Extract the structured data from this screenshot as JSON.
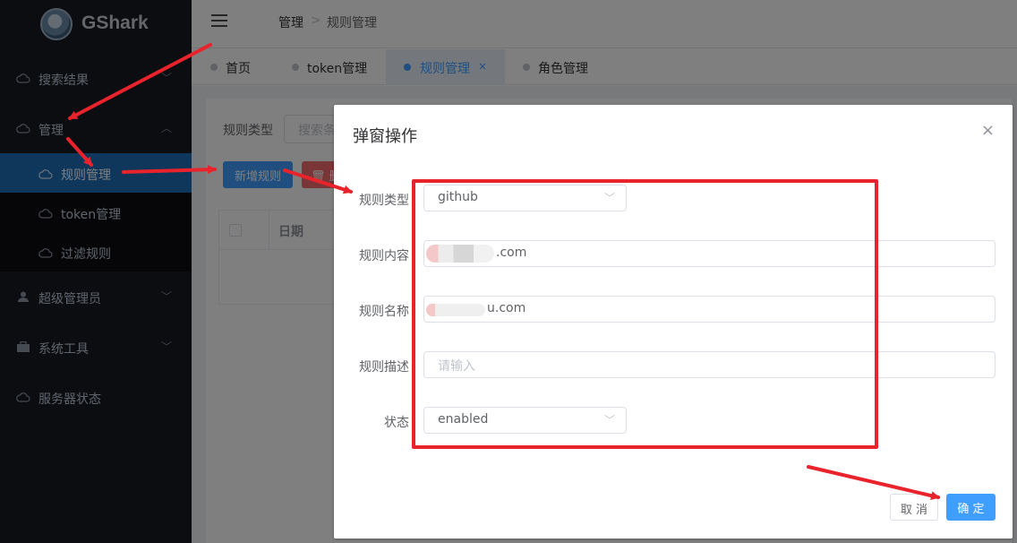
{
  "app": {
    "brand": "GShark"
  },
  "sidebar": {
    "items": [
      {
        "label": "搜索结果",
        "icon": "cloud-icon",
        "expanded": false
      },
      {
        "label": "管理",
        "icon": "cloud-icon",
        "expanded": true,
        "children": [
          {
            "label": "规则管理",
            "icon": "cloud-icon",
            "active": true
          },
          {
            "label": "token管理",
            "icon": "cloud-icon",
            "active": false
          },
          {
            "label": "过滤规则",
            "icon": "cloud-icon",
            "active": false
          }
        ]
      },
      {
        "label": "超级管理员",
        "icon": "user-icon",
        "expanded": false
      },
      {
        "label": "系统工具",
        "icon": "toolbox-icon",
        "expanded": false
      },
      {
        "label": "服务器状态",
        "icon": "cloud-icon",
        "expanded": false
      }
    ]
  },
  "breadcrumb": {
    "items": [
      "管理",
      "规则管理"
    ],
    "separator": ">"
  },
  "tabs": [
    {
      "label": "首页",
      "active": false
    },
    {
      "label": "token管理",
      "active": false
    },
    {
      "label": "规则管理",
      "active": true,
      "close": "×"
    },
    {
      "label": "角色管理",
      "active": false
    }
  ],
  "page": {
    "filter_label": "规则类型",
    "filter_placeholder": "搜索条件",
    "add_button": "新增规则",
    "delete_button": "删",
    "table": {
      "columns": [
        "日期"
      ]
    }
  },
  "dialog": {
    "title": "弹窗操作",
    "close": "×",
    "fields": {
      "type": {
        "label": "规则类型",
        "value": "github"
      },
      "content": {
        "label": "规则内容",
        "value_suffix": ".com"
      },
      "name": {
        "label": "规则名称",
        "value_suffix": "u.com"
      },
      "desc": {
        "label": "规则描述",
        "placeholder": "请输入"
      },
      "status": {
        "label": "状态",
        "value": "enabled"
      }
    },
    "cancel": "取 消",
    "confirm": "确 定"
  },
  "colors": {
    "sidebar_bg": "#191a23",
    "active_menu": "#1f6fb8",
    "primary": "#409eff",
    "annotation": "#e8232c"
  }
}
